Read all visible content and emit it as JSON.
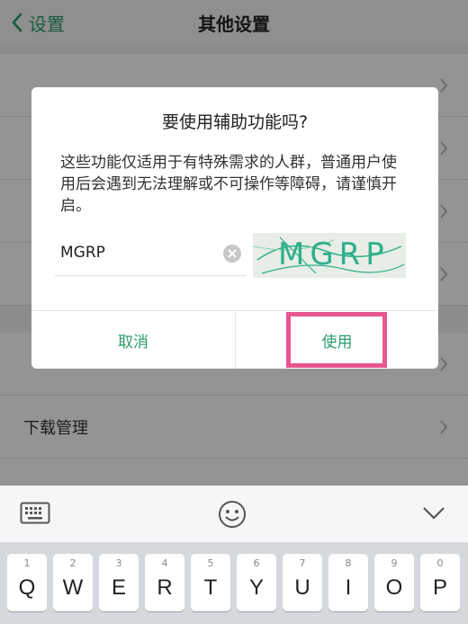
{
  "nav": {
    "back_label": "设置",
    "title": "其他设置"
  },
  "background_list": {
    "items": [
      {
        "label": ""
      },
      {
        "label": ""
      },
      {
        "label": ""
      },
      {
        "label": ""
      }
    ],
    "lower_items": [
      {
        "label": ""
      },
      {
        "label": "下载管理"
      },
      {
        "label": ""
      }
    ]
  },
  "dialog": {
    "title": "要使用辅助功能吗?",
    "message": "这些功能仅适用于有特殊需求的人群，普通用户使用后会遇到无法理解或不可操作等障碍，请谨慎开启。",
    "captcha_value": "MGRP",
    "captcha_image_text": "MGRP",
    "cancel_label": "取消",
    "confirm_label": "使用"
  },
  "keyboard": {
    "keys": [
      {
        "letter": "Q",
        "num": "1"
      },
      {
        "letter": "W",
        "num": "2"
      },
      {
        "letter": "E",
        "num": "3"
      },
      {
        "letter": "R",
        "num": "4"
      },
      {
        "letter": "T",
        "num": "5"
      },
      {
        "letter": "Y",
        "num": "6"
      },
      {
        "letter": "U",
        "num": "7"
      },
      {
        "letter": "I",
        "num": "8"
      },
      {
        "letter": "O",
        "num": "9"
      },
      {
        "letter": "P",
        "num": "0"
      }
    ]
  },
  "colors": {
    "accent": "#2a9d6a",
    "highlight": "#e6568f"
  }
}
